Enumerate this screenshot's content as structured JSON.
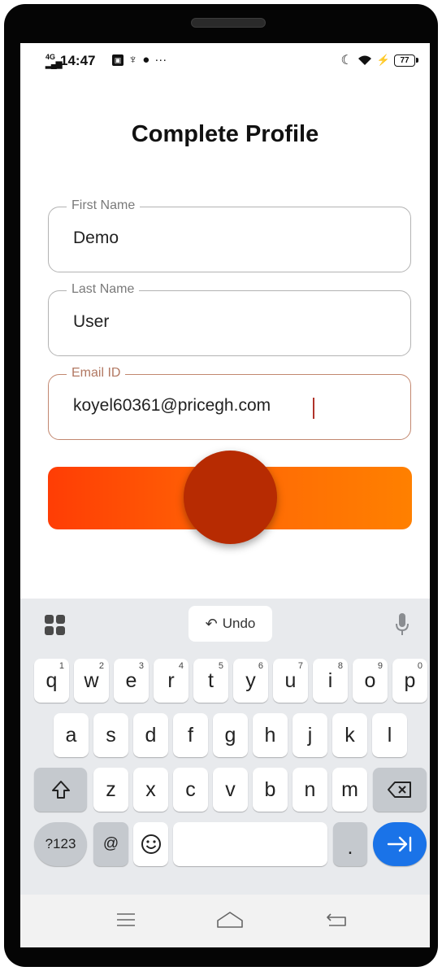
{
  "status_bar": {
    "network": "4G",
    "time": "14:47",
    "battery": "77"
  },
  "page": {
    "title": "Complete Profile"
  },
  "form": {
    "first_name": {
      "label": "First Name",
      "value": "Demo"
    },
    "last_name": {
      "label": "Last Name",
      "value": "User"
    },
    "email": {
      "label": "Email ID",
      "value": "koyel60361@pricegh.com"
    }
  },
  "colors": {
    "button_start": "#ff3d05",
    "button_end": "#ff8000",
    "loader": "#b72b02",
    "keyboard_accent": "#1a73e8"
  },
  "keyboard": {
    "undo_label": "Undo",
    "row1": [
      {
        "key": "q",
        "hint": "1"
      },
      {
        "key": "w",
        "hint": "2"
      },
      {
        "key": "e",
        "hint": "3"
      },
      {
        "key": "r",
        "hint": "4"
      },
      {
        "key": "t",
        "hint": "5"
      },
      {
        "key": "y",
        "hint": "6"
      },
      {
        "key": "u",
        "hint": "7"
      },
      {
        "key": "i",
        "hint": "8"
      },
      {
        "key": "o",
        "hint": "9"
      },
      {
        "key": "p",
        "hint": "0"
      }
    ],
    "row2": [
      "a",
      "s",
      "d",
      "f",
      "g",
      "h",
      "j",
      "k",
      "l"
    ],
    "row3": [
      "z",
      "x",
      "c",
      "v",
      "b",
      "n",
      "m"
    ],
    "symbols_label": "?123",
    "at_label": "@",
    "period_label": "."
  }
}
